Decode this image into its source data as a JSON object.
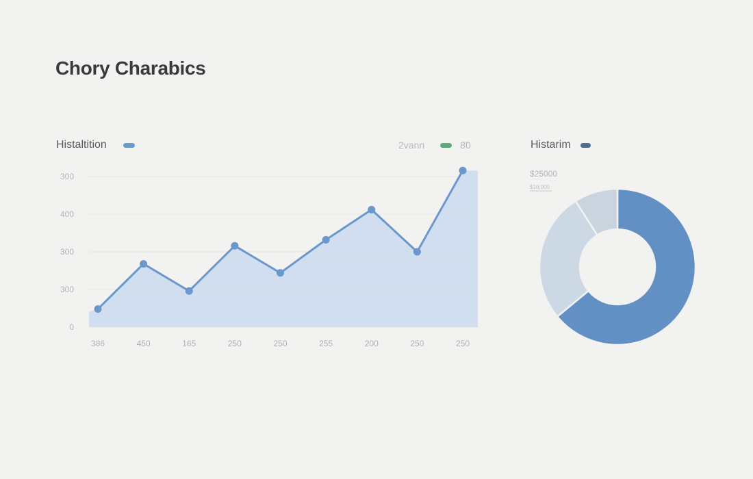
{
  "page": {
    "title": "Chory Charabics"
  },
  "line_panel": {
    "title": "Histaltition",
    "legend": [
      {
        "label": "",
        "color": "#6a9bd0"
      },
      {
        "label": "2vann",
        "color": "#5aaa7c"
      },
      {
        "label": "8̈0",
        "color": ""
      }
    ]
  },
  "donut_panel": {
    "title": "Histarim",
    "legend_color": "#4d6f94",
    "annotation_value": "$25000",
    "annotation_sub": "$10,000"
  },
  "colors": {
    "line": "#6a97cc",
    "area": "#cddcee",
    "donut_main": "#6290c4",
    "donut_light": "#ccd8e3",
    "donut_lighter": "#c9d4df"
  },
  "chart_data": [
    {
      "type": "line",
      "title": "Histaltition",
      "y_tick_labels": [
        "0",
        "300",
        "300",
        "400",
        "300"
      ],
      "ylim": [
        0,
        500
      ],
      "categories": [
        "386",
        "450",
        "165",
        "250",
        "250",
        "255",
        "200",
        "250",
        "250"
      ],
      "series": [
        {
          "values": [
            60,
            210,
            120,
            270,
            180,
            290,
            390,
            250,
            520
          ]
        }
      ],
      "area_fill": true,
      "grid": "horizontal"
    },
    {
      "type": "pie",
      "variant": "donut",
      "title": "Histarim",
      "slices": [
        {
          "value": 64,
          "color": "#6290c4"
        },
        {
          "value": 27,
          "color": "#ccd8e3"
        },
        {
          "value": 9,
          "color": "#c9d4df"
        }
      ]
    }
  ]
}
